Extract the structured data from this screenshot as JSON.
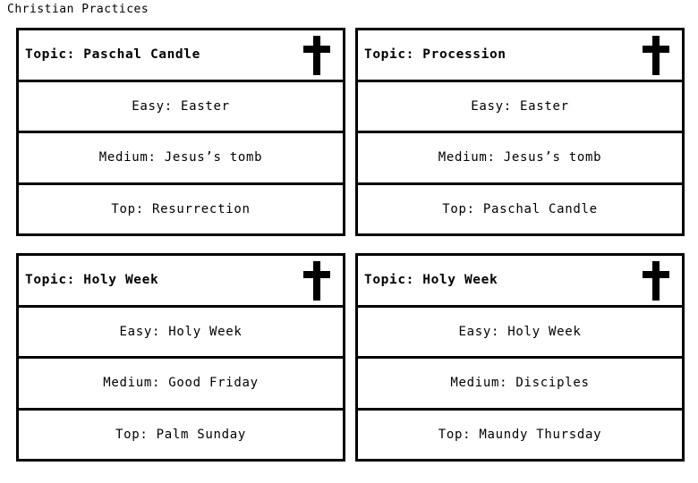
{
  "page": {
    "title": "Christian Practices"
  },
  "icons": {
    "cross": "latin-cross-icon"
  },
  "cards": [
    {
      "header": "Topic: Paschal Candle",
      "rows": [
        "Easy: Easter",
        "Medium: Jesus’s tomb",
        "Top: Resurrection"
      ]
    },
    {
      "header": "Topic: Procession",
      "rows": [
        "Easy: Easter",
        "Medium: Jesus’s tomb",
        "Top: Paschal Candle"
      ]
    },
    {
      "header": "Topic: Holy Week",
      "rows": [
        "Easy: Holy Week",
        "Medium: Good Friday",
        "Top: Palm Sunday"
      ]
    },
    {
      "header": "Topic: Holy Week",
      "rows": [
        "Easy: Holy Week",
        "Medium: Disciples",
        "Top: Maundy Thursday"
      ]
    }
  ],
  "colors": {
    "ink": "#000000",
    "background": "#ffffff"
  }
}
